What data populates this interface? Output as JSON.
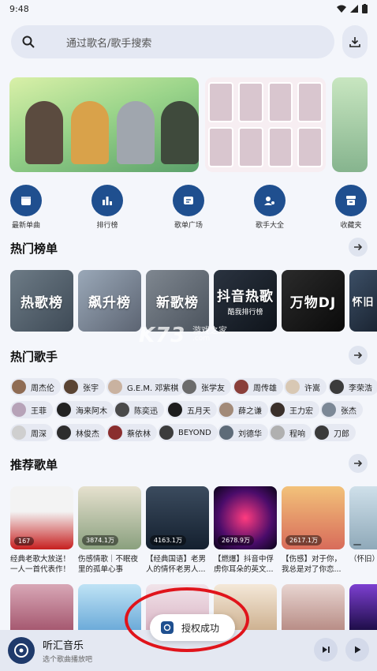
{
  "status_bar": {
    "time": "9:48"
  },
  "search": {
    "placeholder": "通过歌名/歌手搜索"
  },
  "quick_nav": [
    {
      "label": "最新单曲",
      "icon": "calendar-icon"
    },
    {
      "label": "排行榜",
      "icon": "bar-chart-icon"
    },
    {
      "label": "歌单广场",
      "icon": "playlist-icon"
    },
    {
      "label": "歌手大全",
      "icon": "singer-icon"
    },
    {
      "label": "收藏夹",
      "icon": "favorites-icon"
    }
  ],
  "sections": {
    "hot_charts": "热门榜单",
    "hot_singers": "热门歌手",
    "recommended_playlists": "推荐歌单"
  },
  "charts": [
    {
      "label": "热歌榜",
      "sub": ""
    },
    {
      "label": "飙升榜",
      "sub": ""
    },
    {
      "label": "新歌榜",
      "sub": ""
    },
    {
      "label": "抖音热歌",
      "sub": "酷我排行榜"
    },
    {
      "label": "万物DJ",
      "sub": ""
    },
    {
      "label": "怀旧",
      "sub": ""
    }
  ],
  "singers": [
    [
      "周杰伦",
      "张宇",
      "G.E.M. 邓紫棋",
      "张学友",
      "周传雄",
      "许嵩",
      "李荣浩"
    ],
    [
      "王菲",
      "海来阿木",
      "陈奕迅",
      "五月天",
      "薛之谦",
      "王力宏",
      "张杰"
    ],
    [
      "周深",
      "林俊杰",
      "蔡依林",
      "BEYOND",
      "刘德华",
      "程响",
      "刀郎"
    ]
  ],
  "playlists": [
    {
      "count": "167",
      "title": "经典老歌大放送！一人一首代表作！"
    },
    {
      "count": "3874.1万",
      "title": "伤感情歌｜不眠夜里的孤单心事"
    },
    {
      "count": "4163.1万",
      "title": "【经典国语】老男人的情怀老男人..."
    },
    {
      "count": "2678.9万",
      "title": "【燃爆】抖音中俘虏你耳朵的英文..."
    },
    {
      "count": "2617.1万",
      "title": "【伤感】对于你，我总是对了你恋..."
    },
    {
      "count": "",
      "title": "（怀旧）"
    }
  ],
  "toast": {
    "text": "授权成功"
  },
  "player": {
    "title": "听汇音乐",
    "subtitle": "选个歌曲播放吧"
  },
  "watermark": {
    "logo": "K73",
    "line1": "游戏之家",
    "line2": ".com"
  },
  "colors": {
    "accent": "#1f4f8f",
    "highlight_ring": "#e0141b",
    "background": "#f4f6fb"
  }
}
